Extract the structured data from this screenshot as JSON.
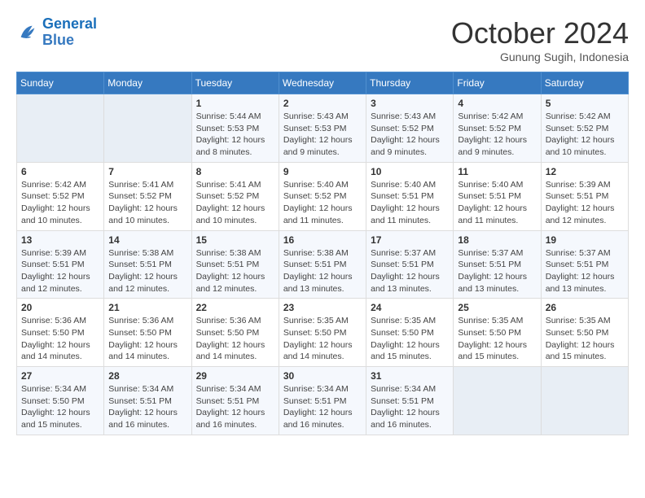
{
  "logo": {
    "general": "General",
    "blue": "Blue"
  },
  "title": "October 2024",
  "location": "Gunung Sugih, Indonesia",
  "days_of_week": [
    "Sunday",
    "Monday",
    "Tuesday",
    "Wednesday",
    "Thursday",
    "Friday",
    "Saturday"
  ],
  "weeks": [
    [
      {
        "day": null
      },
      {
        "day": null
      },
      {
        "day": "1",
        "sunrise": "Sunrise: 5:44 AM",
        "sunset": "Sunset: 5:53 PM",
        "daylight": "Daylight: 12 hours and 8 minutes."
      },
      {
        "day": "2",
        "sunrise": "Sunrise: 5:43 AM",
        "sunset": "Sunset: 5:53 PM",
        "daylight": "Daylight: 12 hours and 9 minutes."
      },
      {
        "day": "3",
        "sunrise": "Sunrise: 5:43 AM",
        "sunset": "Sunset: 5:52 PM",
        "daylight": "Daylight: 12 hours and 9 minutes."
      },
      {
        "day": "4",
        "sunrise": "Sunrise: 5:42 AM",
        "sunset": "Sunset: 5:52 PM",
        "daylight": "Daylight: 12 hours and 9 minutes."
      },
      {
        "day": "5",
        "sunrise": "Sunrise: 5:42 AM",
        "sunset": "Sunset: 5:52 PM",
        "daylight": "Daylight: 12 hours and 10 minutes."
      }
    ],
    [
      {
        "day": "6",
        "sunrise": "Sunrise: 5:42 AM",
        "sunset": "Sunset: 5:52 PM",
        "daylight": "Daylight: 12 hours and 10 minutes."
      },
      {
        "day": "7",
        "sunrise": "Sunrise: 5:41 AM",
        "sunset": "Sunset: 5:52 PM",
        "daylight": "Daylight: 12 hours and 10 minutes."
      },
      {
        "day": "8",
        "sunrise": "Sunrise: 5:41 AM",
        "sunset": "Sunset: 5:52 PM",
        "daylight": "Daylight: 12 hours and 10 minutes."
      },
      {
        "day": "9",
        "sunrise": "Sunrise: 5:40 AM",
        "sunset": "Sunset: 5:52 PM",
        "daylight": "Daylight: 12 hours and 11 minutes."
      },
      {
        "day": "10",
        "sunrise": "Sunrise: 5:40 AM",
        "sunset": "Sunset: 5:51 PM",
        "daylight": "Daylight: 12 hours and 11 minutes."
      },
      {
        "day": "11",
        "sunrise": "Sunrise: 5:40 AM",
        "sunset": "Sunset: 5:51 PM",
        "daylight": "Daylight: 12 hours and 11 minutes."
      },
      {
        "day": "12",
        "sunrise": "Sunrise: 5:39 AM",
        "sunset": "Sunset: 5:51 PM",
        "daylight": "Daylight: 12 hours and 12 minutes."
      }
    ],
    [
      {
        "day": "13",
        "sunrise": "Sunrise: 5:39 AM",
        "sunset": "Sunset: 5:51 PM",
        "daylight": "Daylight: 12 hours and 12 minutes."
      },
      {
        "day": "14",
        "sunrise": "Sunrise: 5:38 AM",
        "sunset": "Sunset: 5:51 PM",
        "daylight": "Daylight: 12 hours and 12 minutes."
      },
      {
        "day": "15",
        "sunrise": "Sunrise: 5:38 AM",
        "sunset": "Sunset: 5:51 PM",
        "daylight": "Daylight: 12 hours and 12 minutes."
      },
      {
        "day": "16",
        "sunrise": "Sunrise: 5:38 AM",
        "sunset": "Sunset: 5:51 PM",
        "daylight": "Daylight: 12 hours and 13 minutes."
      },
      {
        "day": "17",
        "sunrise": "Sunrise: 5:37 AM",
        "sunset": "Sunset: 5:51 PM",
        "daylight": "Daylight: 12 hours and 13 minutes."
      },
      {
        "day": "18",
        "sunrise": "Sunrise: 5:37 AM",
        "sunset": "Sunset: 5:51 PM",
        "daylight": "Daylight: 12 hours and 13 minutes."
      },
      {
        "day": "19",
        "sunrise": "Sunrise: 5:37 AM",
        "sunset": "Sunset: 5:51 PM",
        "daylight": "Daylight: 12 hours and 13 minutes."
      }
    ],
    [
      {
        "day": "20",
        "sunrise": "Sunrise: 5:36 AM",
        "sunset": "Sunset: 5:50 PM",
        "daylight": "Daylight: 12 hours and 14 minutes."
      },
      {
        "day": "21",
        "sunrise": "Sunrise: 5:36 AM",
        "sunset": "Sunset: 5:50 PM",
        "daylight": "Daylight: 12 hours and 14 minutes."
      },
      {
        "day": "22",
        "sunrise": "Sunrise: 5:36 AM",
        "sunset": "Sunset: 5:50 PM",
        "daylight": "Daylight: 12 hours and 14 minutes."
      },
      {
        "day": "23",
        "sunrise": "Sunrise: 5:35 AM",
        "sunset": "Sunset: 5:50 PM",
        "daylight": "Daylight: 12 hours and 14 minutes."
      },
      {
        "day": "24",
        "sunrise": "Sunrise: 5:35 AM",
        "sunset": "Sunset: 5:50 PM",
        "daylight": "Daylight: 12 hours and 15 minutes."
      },
      {
        "day": "25",
        "sunrise": "Sunrise: 5:35 AM",
        "sunset": "Sunset: 5:50 PM",
        "daylight": "Daylight: 12 hours and 15 minutes."
      },
      {
        "day": "26",
        "sunrise": "Sunrise: 5:35 AM",
        "sunset": "Sunset: 5:50 PM",
        "daylight": "Daylight: 12 hours and 15 minutes."
      }
    ],
    [
      {
        "day": "27",
        "sunrise": "Sunrise: 5:34 AM",
        "sunset": "Sunset: 5:50 PM",
        "daylight": "Daylight: 12 hours and 15 minutes."
      },
      {
        "day": "28",
        "sunrise": "Sunrise: 5:34 AM",
        "sunset": "Sunset: 5:51 PM",
        "daylight": "Daylight: 12 hours and 16 minutes."
      },
      {
        "day": "29",
        "sunrise": "Sunrise: 5:34 AM",
        "sunset": "Sunset: 5:51 PM",
        "daylight": "Daylight: 12 hours and 16 minutes."
      },
      {
        "day": "30",
        "sunrise": "Sunrise: 5:34 AM",
        "sunset": "Sunset: 5:51 PM",
        "daylight": "Daylight: 12 hours and 16 minutes."
      },
      {
        "day": "31",
        "sunrise": "Sunrise: 5:34 AM",
        "sunset": "Sunset: 5:51 PM",
        "daylight": "Daylight: 12 hours and 16 minutes."
      },
      {
        "day": null
      },
      {
        "day": null
      }
    ]
  ]
}
